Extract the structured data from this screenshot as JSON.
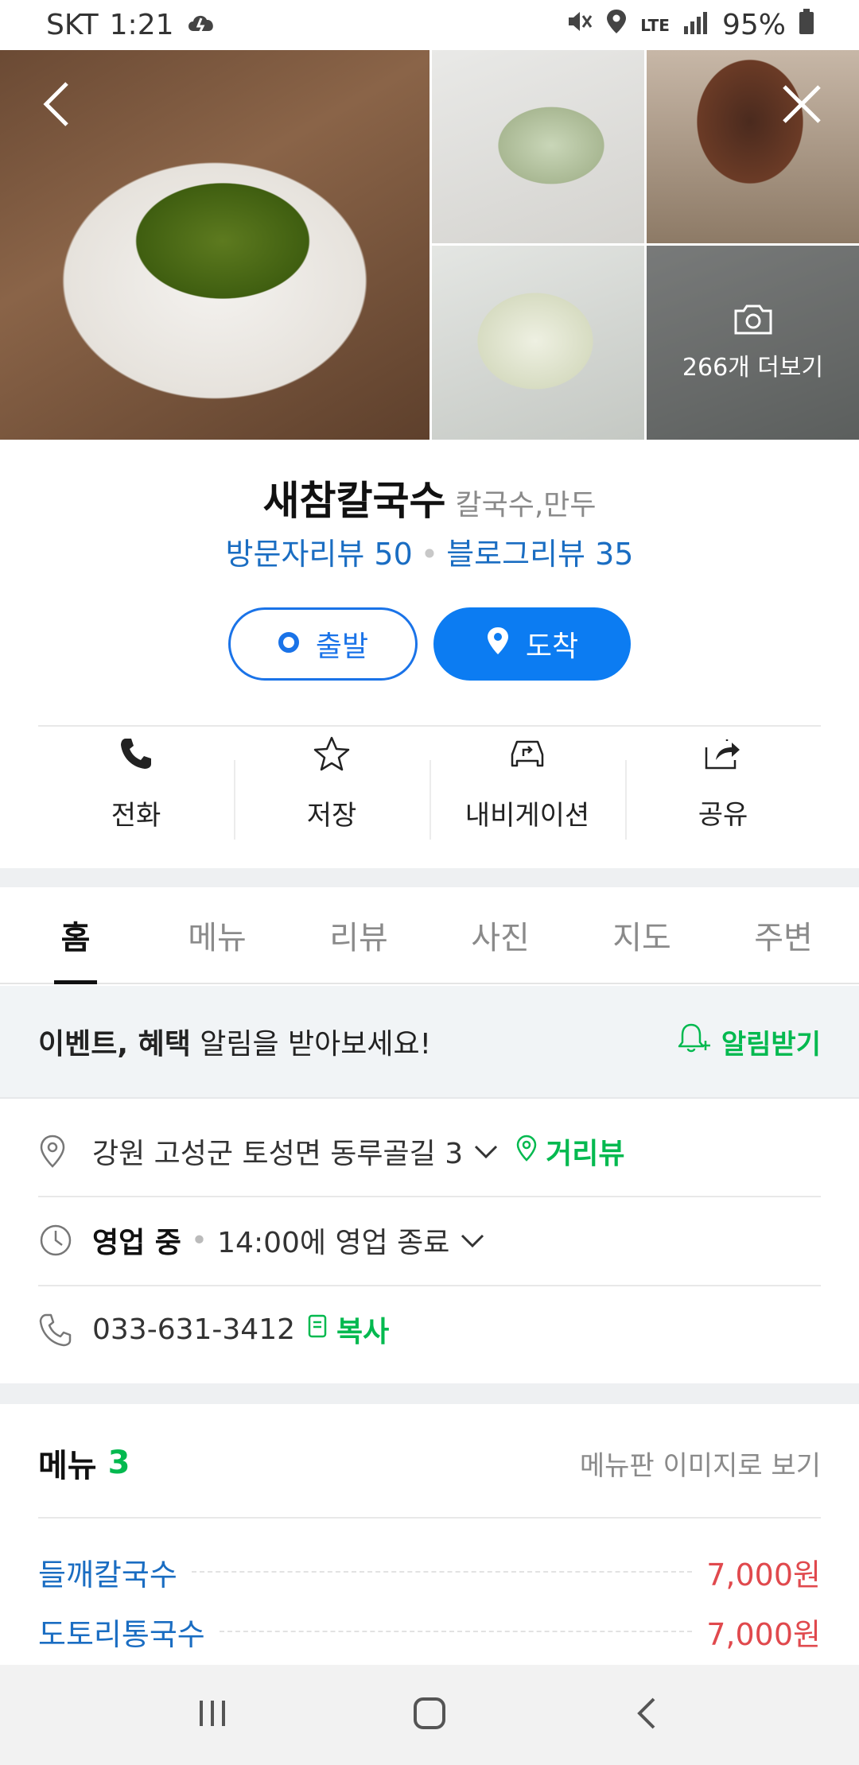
{
  "status_bar": {
    "carrier": "SKT",
    "time": "1:21",
    "network": "LTE",
    "battery": "95%"
  },
  "photos": {
    "more_label": "266개 더보기"
  },
  "place": {
    "name": "새참칼국수",
    "category": "칼국수,만두",
    "visitor_reviews": "방문자리뷰 50",
    "blog_reviews": "블로그리뷰 35"
  },
  "route_buttons": {
    "depart": "출발",
    "arrive": "도착"
  },
  "actions": {
    "call": "전화",
    "save": "저장",
    "navigation": "내비게이션",
    "share": "공유"
  },
  "tabs": [
    "홈",
    "메뉴",
    "리뷰",
    "사진",
    "지도",
    "주변"
  ],
  "alert": {
    "bold_text": "이벤트, 혜택",
    "text": " 알림을 받아보세요!",
    "subscribe": "알림받기"
  },
  "info": {
    "address": "강원 고성군 토성면 동루골길 3",
    "street_view": "거리뷰",
    "status": "영업 중",
    "hours": "14:00에 영업 종료",
    "phone": "033-631-3412",
    "copy": "복사"
  },
  "menu": {
    "title": "메뉴",
    "count": "3",
    "image_link": "메뉴판 이미지로 보기",
    "items": [
      {
        "name": "들깨칼국수",
        "price": "7,000원"
      },
      {
        "name": "도토리통국수",
        "price": "7,000원"
      }
    ]
  },
  "colors": {
    "primary_blue": "#0c7cf2",
    "link_blue": "#1a6dc2",
    "naver_green": "#03b94f",
    "price_red": "#e0494d"
  }
}
